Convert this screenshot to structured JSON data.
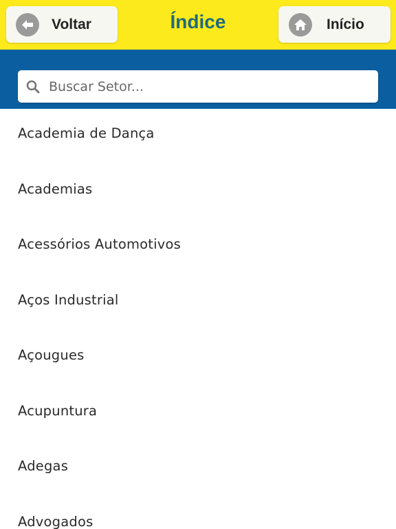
{
  "header": {
    "back_label": "Voltar",
    "back_icon": "arrow-left-icon",
    "title": "Índice",
    "home_label": "Início",
    "home_icon": "home-icon",
    "colors": {
      "header_bg": "#fcea1c",
      "title": "#1f6a7c",
      "band_bg": "#0b5fa0"
    }
  },
  "search": {
    "placeholder": "Buscar Setor...",
    "value": "",
    "icon": "search-icon"
  },
  "list": {
    "items": [
      "Academia de Dança",
      "Academias",
      "Acessórios Automotivos",
      "Aços Industrial",
      "Açougues",
      "Acupuntura",
      "Adegas",
      "Advogados"
    ]
  }
}
